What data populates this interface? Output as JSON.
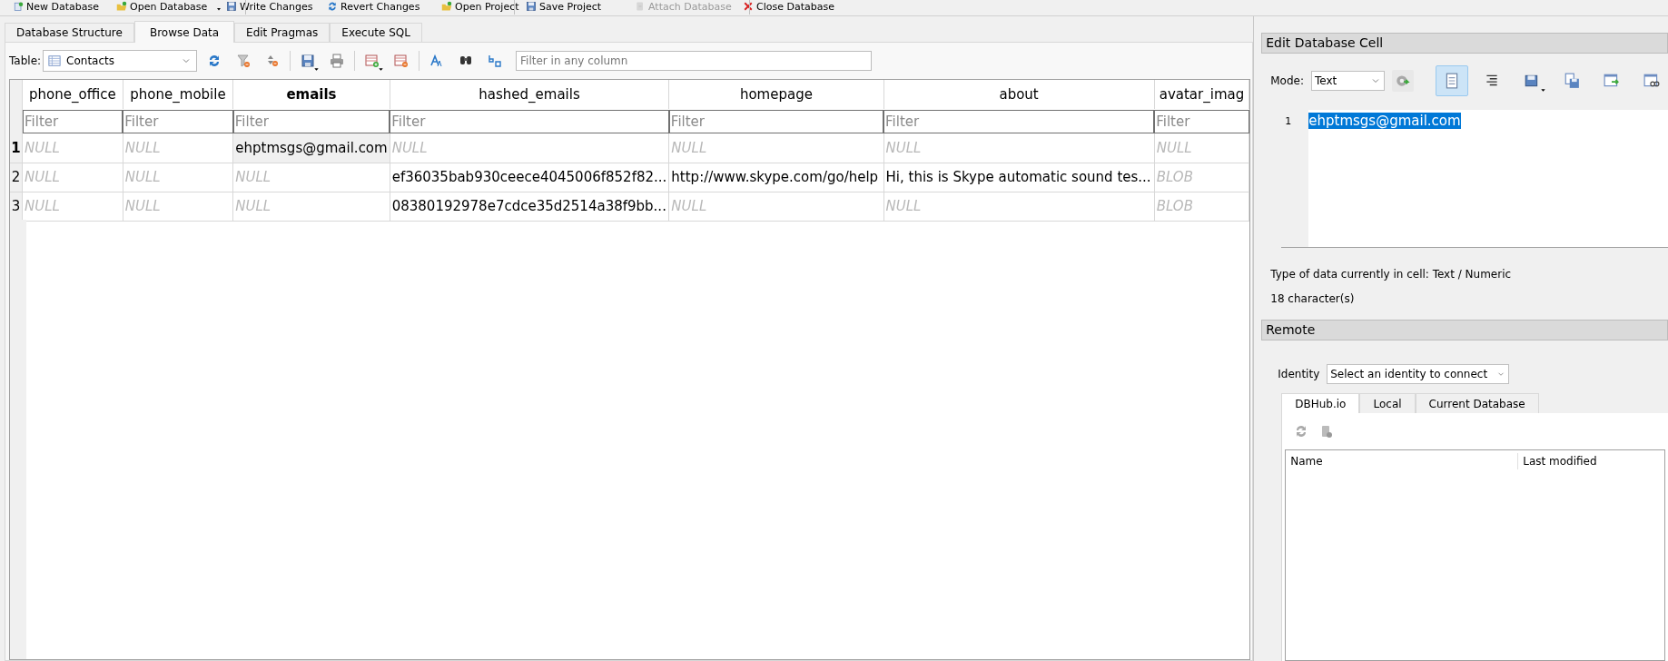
{
  "main_toolbar": [
    {
      "label": "New Database",
      "disabled": false,
      "has_menu": false
    },
    {
      "label": "Open Database",
      "disabled": false,
      "has_menu": true
    },
    {
      "label": "Write Changes",
      "disabled": false,
      "has_menu": false
    },
    {
      "label": "Revert Changes",
      "disabled": false,
      "has_menu": false
    },
    {
      "label": "Open Project",
      "disabled": false,
      "has_menu": false
    },
    {
      "label": "Save Project",
      "disabled": false,
      "has_menu": false
    },
    {
      "label": "Attach Database",
      "disabled": true,
      "has_menu": false
    },
    {
      "label": "Close Database",
      "disabled": false,
      "has_menu": false
    }
  ],
  "tabs": [
    {
      "label": "Database Structure",
      "selected": false
    },
    {
      "label": "Browse Data",
      "selected": true
    },
    {
      "label": "Edit Pragmas",
      "selected": false
    },
    {
      "label": "Execute SQL",
      "selected": false
    }
  ],
  "browse_toolbar": {
    "table_label": "Table:",
    "table": "Contacts",
    "filter_placeholder": "Filter in any column"
  },
  "grid": {
    "columns": [
      {
        "name": "phone_office",
        "selected": false,
        "placeholder": "Filter"
      },
      {
        "name": "phone_mobile",
        "selected": false,
        "placeholder": "Filter"
      },
      {
        "name": "emails",
        "selected": true,
        "placeholder": "Filter"
      },
      {
        "name": "hashed_emails",
        "selected": false,
        "placeholder": "Filter"
      },
      {
        "name": "homepage",
        "selected": false,
        "placeholder": "Filter"
      },
      {
        "name": "about",
        "selected": false,
        "placeholder": "Filter"
      },
      {
        "name": "avatar_imag",
        "selected": false,
        "placeholder": "Filter"
      }
    ],
    "rows": [
      {
        "number": "1",
        "selected": true,
        "cells": [
          {
            "kind": "null",
            "text": "NULL",
            "selected": false
          },
          {
            "kind": "null",
            "text": "NULL",
            "selected": false
          },
          {
            "kind": "value",
            "text": "ehptmsgs@gmail.com",
            "selected": true
          },
          {
            "kind": "null",
            "text": "NULL",
            "selected": false
          },
          {
            "kind": "null",
            "text": "NULL",
            "selected": false
          },
          {
            "kind": "null",
            "text": "NULL",
            "selected": false
          },
          {
            "kind": "null",
            "text": "NULL",
            "selected": false
          }
        ]
      },
      {
        "number": "2",
        "selected": false,
        "cells": [
          {
            "kind": "null",
            "text": "NULL",
            "selected": false
          },
          {
            "kind": "null",
            "text": "NULL",
            "selected": false
          },
          {
            "kind": "null",
            "text": "NULL",
            "selected": false
          },
          {
            "kind": "value",
            "text": "ef36035bab930ceece4045006f852f82...",
            "selected": false
          },
          {
            "kind": "value",
            "text": "http://www.skype.com/go/help",
            "selected": false
          },
          {
            "kind": "value",
            "text": "Hi, this is Skype automatic sound tes...",
            "selected": false
          },
          {
            "kind": "null",
            "text": "BLOB",
            "selected": false
          }
        ]
      },
      {
        "number": "3",
        "selected": false,
        "cells": [
          {
            "kind": "null",
            "text": "NULL",
            "selected": false
          },
          {
            "kind": "null",
            "text": "NULL",
            "selected": false
          },
          {
            "kind": "null",
            "text": "NULL",
            "selected": false
          },
          {
            "kind": "value",
            "text": "08380192978e7cdce35d2514a38f9bb...",
            "selected": false
          },
          {
            "kind": "null",
            "text": "NULL",
            "selected": false
          },
          {
            "kind": "null",
            "text": "NULL",
            "selected": false
          },
          {
            "kind": "null",
            "text": "BLOB",
            "selected": false
          }
        ]
      }
    ]
  },
  "edit_cell": {
    "title": "Edit Database Cell",
    "mode_label": "Mode:",
    "mode": "Text",
    "text_mode_selected": true,
    "line_number": "1",
    "content": "ehptmsgs@gmail.com",
    "type_info": "Type of data currently in cell: Text / Numeric",
    "char_count": "18 character(s)"
  },
  "remote": {
    "title": "Remote",
    "identity_label": "Identity",
    "identity": "Select an identity to connect",
    "tabs": [
      {
        "label": "DBHub.io",
        "selected": true
      },
      {
        "label": "Local",
        "selected": false
      },
      {
        "label": "Current Database",
        "selected": false
      }
    ],
    "columns": [
      "Name",
      "Last modified"
    ]
  }
}
